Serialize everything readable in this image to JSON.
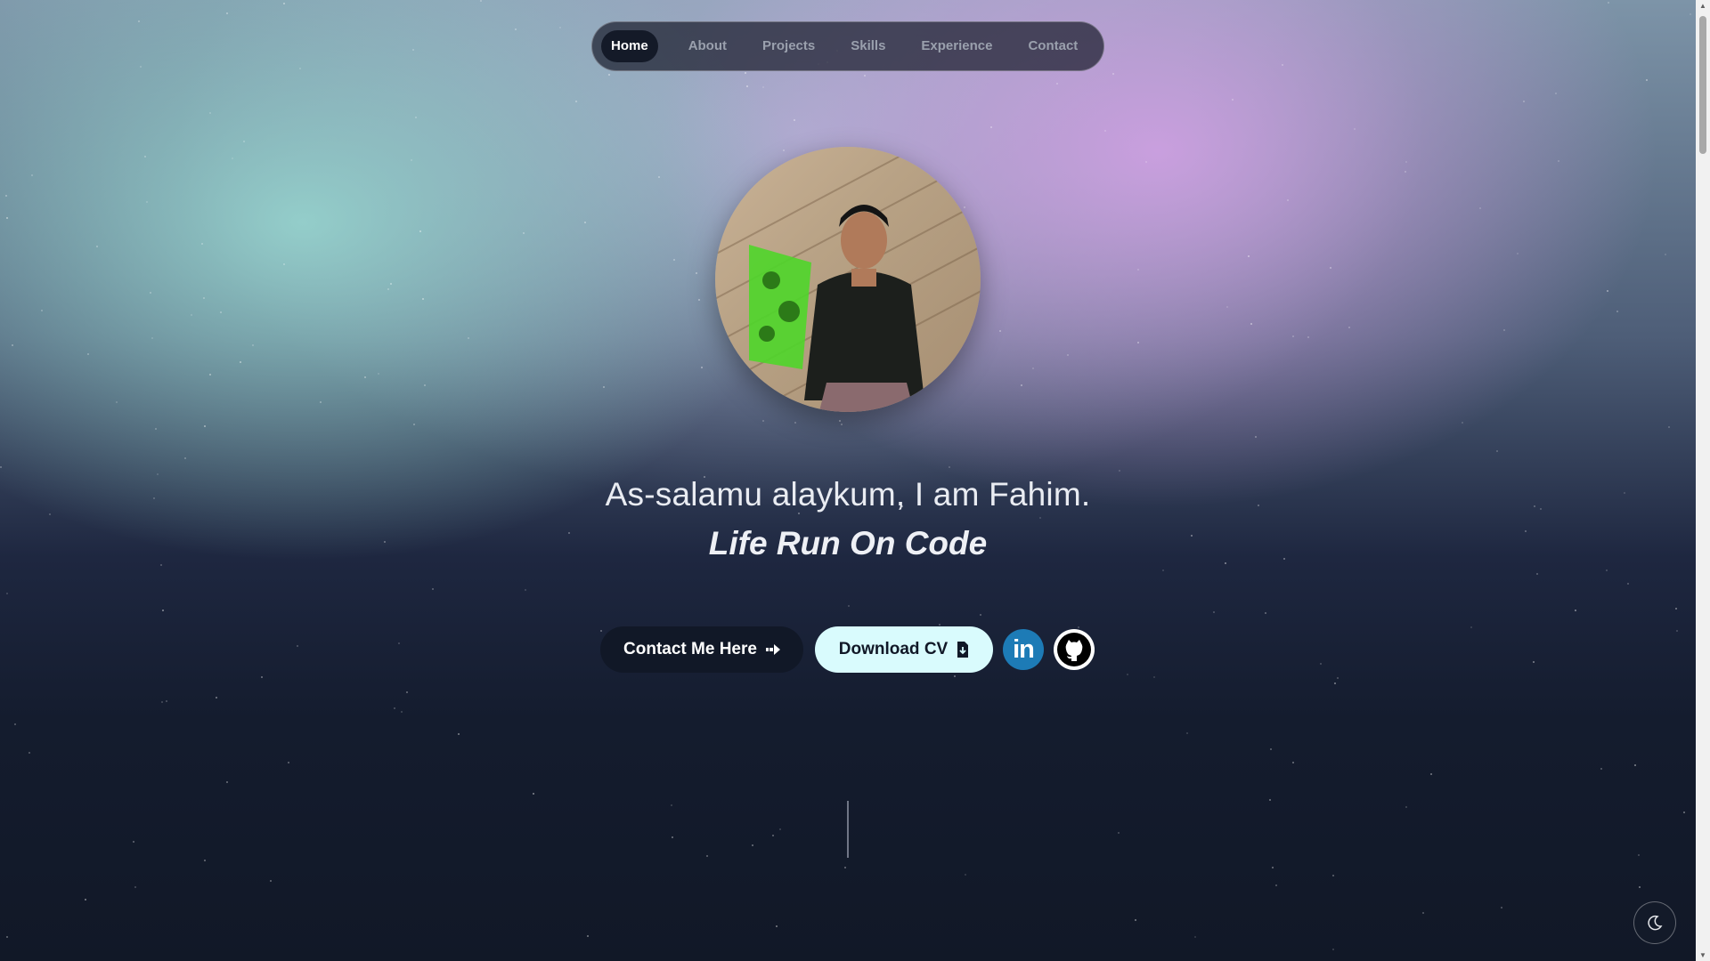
{
  "nav": {
    "items": [
      {
        "label": "Home",
        "active": true
      },
      {
        "label": "About"
      },
      {
        "label": "Projects"
      },
      {
        "label": "Skills"
      },
      {
        "label": "Experience"
      },
      {
        "label": "Contact"
      }
    ]
  },
  "hero": {
    "greeting": "As-salamu alaykum, I am Fahim.",
    "tagline": "Life Run On Code",
    "contact_label": "Contact Me Here",
    "cv_label": "Download CV"
  },
  "icons": {
    "contact_arrow": "arrow-right-icon",
    "cv_file": "file-download-icon",
    "linkedin": "linkedin-icon",
    "github": "github-icon",
    "theme": "moon-icon"
  },
  "linkedin_text": "in",
  "colors": {
    "accent_cyan": "#d9fbfd",
    "dark_button": "#111827",
    "linkedin_blue": "#1d7bb6"
  }
}
